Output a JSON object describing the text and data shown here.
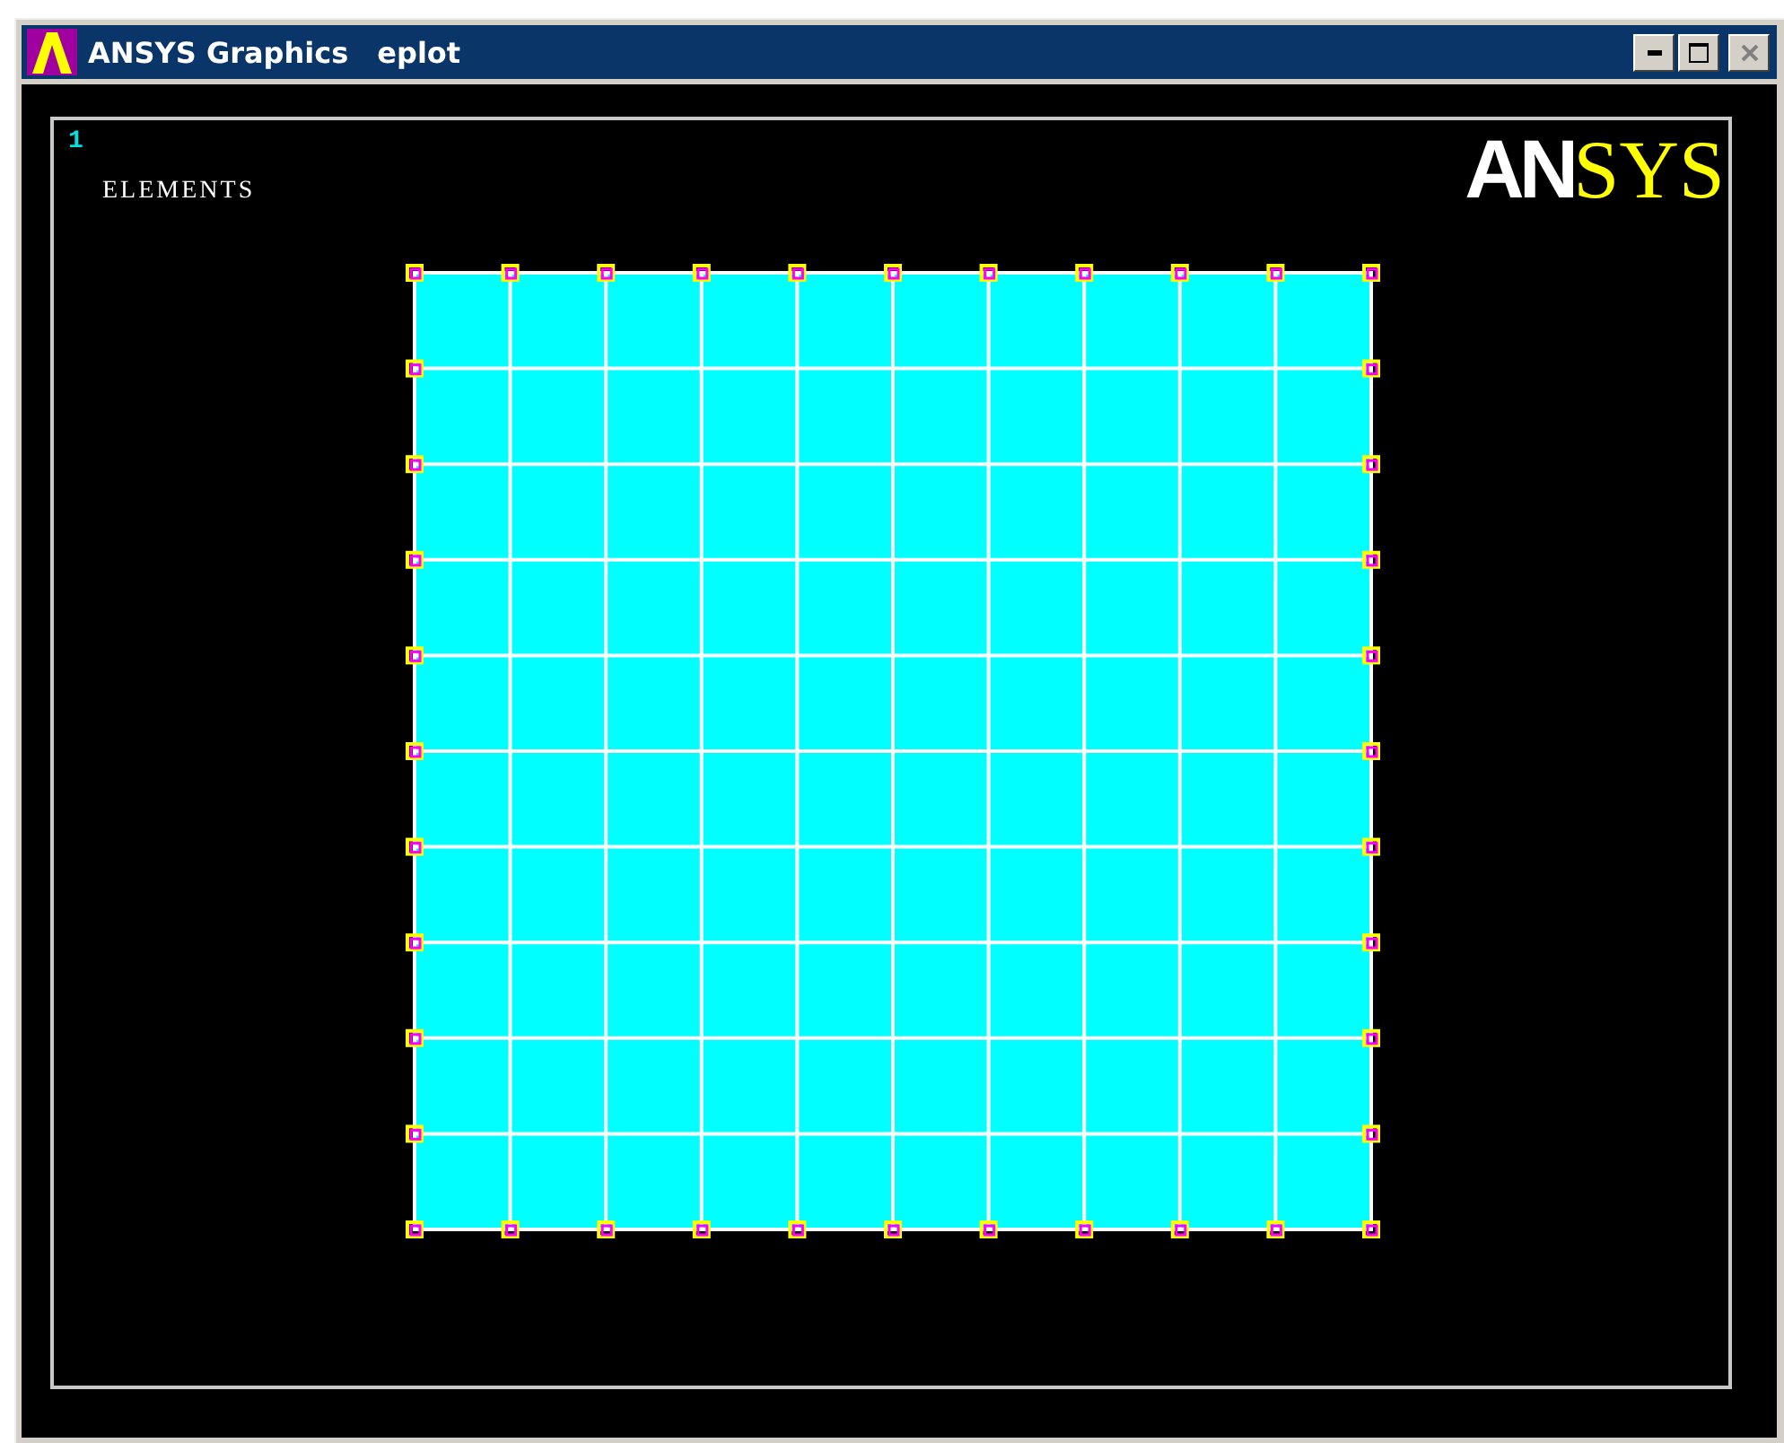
{
  "window": {
    "title": "ANSYS Graphics",
    "subtitle": "eplot"
  },
  "title_buttons": [
    {
      "kind": "minimize",
      "disabled": false
    },
    {
      "kind": "maximize",
      "disabled": false
    },
    {
      "kind": "close",
      "disabled": true
    }
  ],
  "graphics": {
    "window_number": "1",
    "label": "ELEMENTS",
    "logo": {
      "first": "AN",
      "second": "SYS"
    }
  }
}
